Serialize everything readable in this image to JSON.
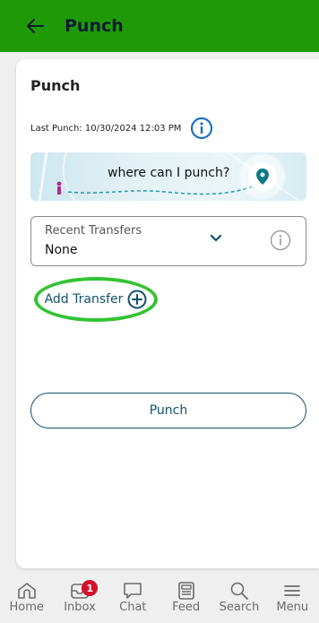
{
  "header": {
    "title": "Punch",
    "back_icon": "arrow-left-icon"
  },
  "card": {
    "title": "Punch",
    "last_punch": "Last Punch: 10/30/2024 12:03 PM",
    "map_banner": {
      "text": "where can I punch?",
      "icon": "map-pin-icon"
    },
    "recent_transfers": {
      "label": "Recent Transfers",
      "value": "None"
    },
    "add_transfer_label": "Add Transfer",
    "punch_button_label": "Punch"
  },
  "bottom_nav": {
    "items": [
      {
        "label": "Home",
        "icon": "home-icon"
      },
      {
        "label": "Inbox",
        "icon": "inbox-icon",
        "badge": "1"
      },
      {
        "label": "Chat",
        "icon": "chat-icon"
      },
      {
        "label": "Feed",
        "icon": "feed-icon"
      },
      {
        "label": "Search",
        "icon": "search-icon"
      },
      {
        "label": "Menu",
        "icon": "menu-icon"
      }
    ]
  },
  "colors": {
    "header_bg": "#1f9a06",
    "accent": "#12516b",
    "highlight": "#33c333",
    "badge": "#d3102b",
    "pin": "#0c7a86"
  }
}
